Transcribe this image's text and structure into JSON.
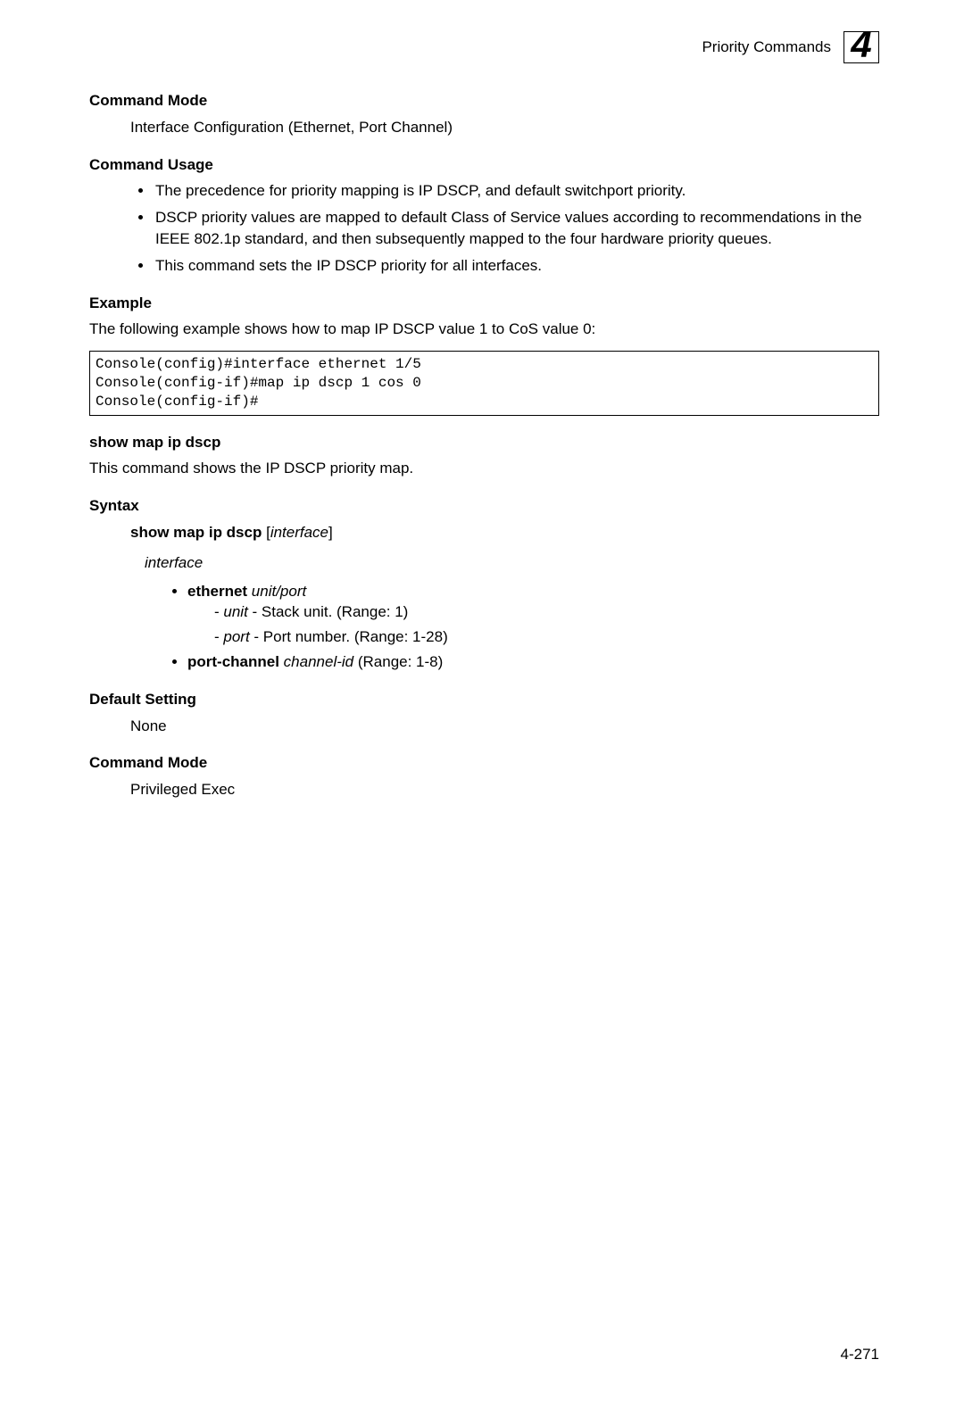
{
  "header": {
    "title": "Priority Commands",
    "chapter": "4"
  },
  "sections": {
    "command_mode1_h": "Command Mode",
    "command_mode1_body": "Interface Configuration (Ethernet, Port Channel)",
    "command_usage_h": "Command Usage",
    "usage_b1": "The precedence for priority mapping is IP DSCP, and default switchport priority.",
    "usage_b2": "DSCP priority values are mapped to default Class of Service values according to recommendations in the IEEE 802.1p standard, and then subsequently mapped to the four hardware priority queues.",
    "usage_b3": "This command sets the IP DSCP priority for all interfaces.",
    "example_h": "Example",
    "example_intro": "The following example shows how to map IP DSCP value 1 to CoS value 0:",
    "example_code": "Console(config)#interface ethernet 1/5\nConsole(config-if)#map ip dscp 1 cos 0\nConsole(config-if)#",
    "show_h": "show map ip dscp",
    "show_desc": "This command shows the IP DSCP priority map.",
    "syntax_h": "Syntax",
    "syntax_cmd_bold": "show map ip dscp",
    "syntax_cmd_rest": " [",
    "syntax_cmd_interface": "interface",
    "syntax_cmd_end": "]",
    "interface_label": "interface",
    "eth_bold": "ethernet",
    "eth_ital": " unit/port",
    "unit_ital": "unit",
    "unit_rest": " - Stack unit. (Range: 1)",
    "port_ital": "port",
    "port_rest": " - Port number. (Range: 1-28)",
    "pc_bold": "port-channel",
    "pc_ital": " channel-id",
    "pc_rest": " (Range: 1-8)",
    "default_h": "Default Setting",
    "default_body": "None",
    "cmdmode2_h": "Command Mode",
    "cmdmode2_body": "Privileged Exec"
  },
  "footer": {
    "page": "4-271"
  }
}
